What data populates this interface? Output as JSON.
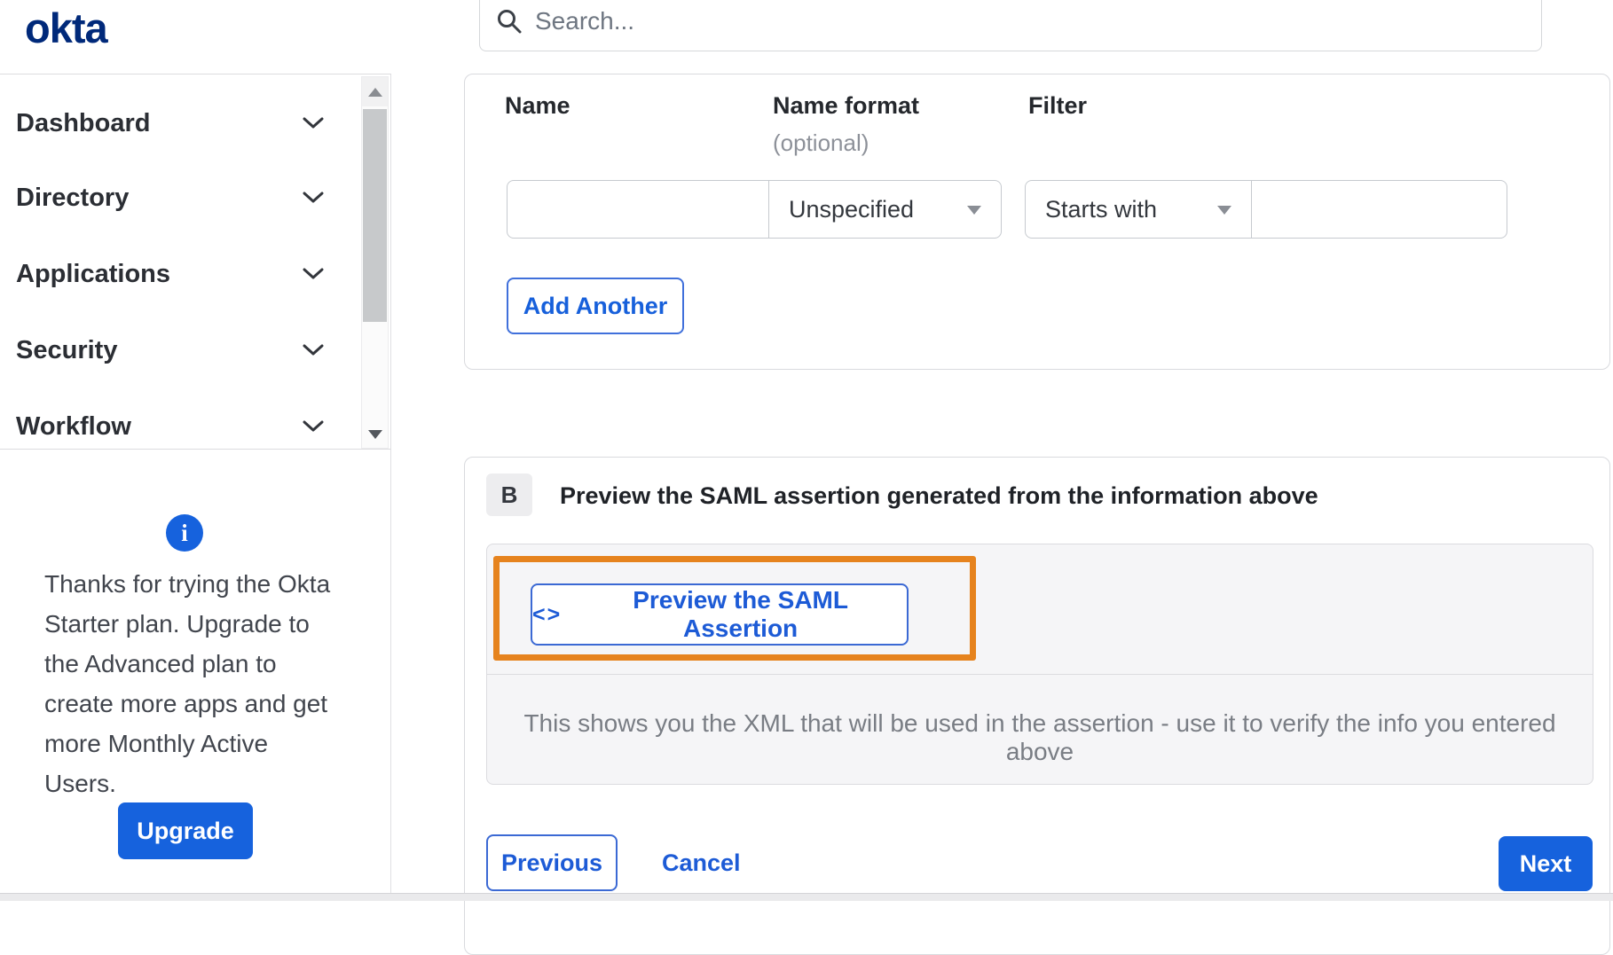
{
  "brand": {
    "logo_text": "okta"
  },
  "search": {
    "placeholder": "Search..."
  },
  "sidebar": {
    "items": [
      {
        "label": "Dashboard"
      },
      {
        "label": "Directory"
      },
      {
        "label": "Applications"
      },
      {
        "label": "Security"
      },
      {
        "label": "Workflow"
      }
    ],
    "notice": {
      "text": "Thanks for trying the Okta Starter plan. Upgrade to the Advanced plan to create more apps and get more Monthly Active Users."
    },
    "upgrade_label": "Upgrade"
  },
  "attribute_form": {
    "labels": {
      "name": "Name",
      "name_format": "Name format",
      "optional": "(optional)",
      "filter": "Filter"
    },
    "name_value": "",
    "name_format_selected": "Unspecified",
    "filter_type_selected": "Starts with",
    "filter_value": "",
    "add_another_label": "Add Another"
  },
  "preview_section": {
    "step_label": "B",
    "title": "Preview the SAML assertion generated from the information above",
    "code_icon_glyph": "<>",
    "preview_button_label": "Preview the SAML Assertion",
    "description": "This shows you the XML that will be used in the assertion - use it to verify the info you entered above"
  },
  "footer": {
    "previous_label": "Previous",
    "cancel_label": "Cancel",
    "next_label": "Next"
  },
  "colors": {
    "primary_blue": "#1662dd",
    "logo_navy": "#00297a",
    "highlight_orange": "#e6831e"
  }
}
